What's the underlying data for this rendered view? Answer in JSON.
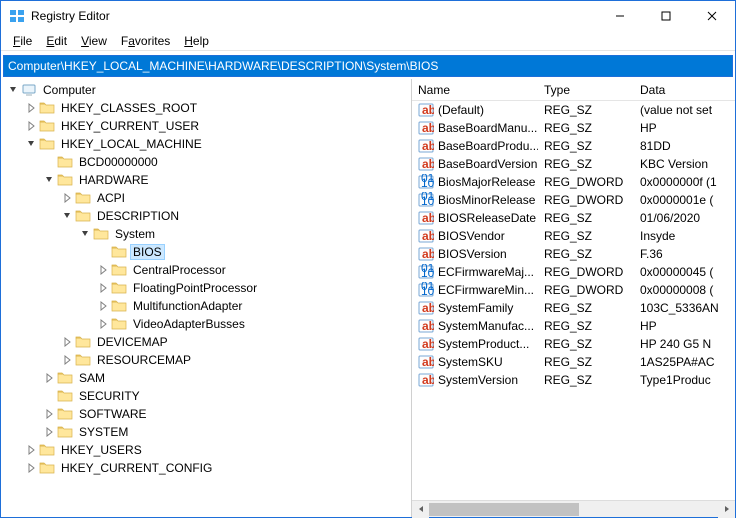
{
  "window": {
    "title": "Registry Editor"
  },
  "menu": {
    "file": "File",
    "edit": "Edit",
    "view": "View",
    "favorites": "Favorites",
    "help": "Help"
  },
  "address_path": "Computer\\HKEY_LOCAL_MACHINE\\HARDWARE\\DESCRIPTION\\System\\BIOS",
  "tree": [
    {
      "label": "Computer",
      "depth": 0,
      "expander": "open",
      "icon": "computer",
      "selected": false
    },
    {
      "label": "HKEY_CLASSES_ROOT",
      "depth": 1,
      "expander": "closed",
      "icon": "folder"
    },
    {
      "label": "HKEY_CURRENT_USER",
      "depth": 1,
      "expander": "closed",
      "icon": "folder"
    },
    {
      "label": "HKEY_LOCAL_MACHINE",
      "depth": 1,
      "expander": "open",
      "icon": "folder"
    },
    {
      "label": "BCD00000000",
      "depth": 2,
      "expander": "none",
      "icon": "folder"
    },
    {
      "label": "HARDWARE",
      "depth": 2,
      "expander": "open",
      "icon": "folder"
    },
    {
      "label": "ACPI",
      "depth": 3,
      "expander": "closed",
      "icon": "folder"
    },
    {
      "label": "DESCRIPTION",
      "depth": 3,
      "expander": "open",
      "icon": "folder"
    },
    {
      "label": "System",
      "depth": 4,
      "expander": "open",
      "icon": "folder"
    },
    {
      "label": "BIOS",
      "depth": 5,
      "expander": "none",
      "icon": "folder",
      "selected": true
    },
    {
      "label": "CentralProcessor",
      "depth": 5,
      "expander": "closed",
      "icon": "folder"
    },
    {
      "label": "FloatingPointProcessor",
      "depth": 5,
      "expander": "closed",
      "icon": "folder"
    },
    {
      "label": "MultifunctionAdapter",
      "depth": 5,
      "expander": "closed",
      "icon": "folder"
    },
    {
      "label": "VideoAdapterBusses",
      "depth": 5,
      "expander": "closed",
      "icon": "folder"
    },
    {
      "label": "DEVICEMAP",
      "depth": 3,
      "expander": "closed",
      "icon": "folder"
    },
    {
      "label": "RESOURCEMAP",
      "depth": 3,
      "expander": "closed",
      "icon": "folder"
    },
    {
      "label": "SAM",
      "depth": 2,
      "expander": "closed",
      "icon": "folder"
    },
    {
      "label": "SECURITY",
      "depth": 2,
      "expander": "none",
      "icon": "folder"
    },
    {
      "label": "SOFTWARE",
      "depth": 2,
      "expander": "closed",
      "icon": "folder"
    },
    {
      "label": "SYSTEM",
      "depth": 2,
      "expander": "closed",
      "icon": "folder"
    },
    {
      "label": "HKEY_USERS",
      "depth": 1,
      "expander": "closed",
      "icon": "folder"
    },
    {
      "label": "HKEY_CURRENT_CONFIG",
      "depth": 1,
      "expander": "closed",
      "icon": "folder"
    }
  ],
  "columns": {
    "name": "Name",
    "type": "Type",
    "data": "Data"
  },
  "values": [
    {
      "icon": "str",
      "name": "(Default)",
      "type": "REG_SZ",
      "data": "(value not set"
    },
    {
      "icon": "str",
      "name": "BaseBoardManu...",
      "type": "REG_SZ",
      "data": "HP"
    },
    {
      "icon": "str",
      "name": "BaseBoardProdu...",
      "type": "REG_SZ",
      "data": "81DD"
    },
    {
      "icon": "str",
      "name": "BaseBoardVersion",
      "type": "REG_SZ",
      "data": "KBC Version "
    },
    {
      "icon": "bin",
      "name": "BiosMajorRelease",
      "type": "REG_DWORD",
      "data": "0x0000000f (1"
    },
    {
      "icon": "bin",
      "name": "BiosMinorRelease",
      "type": "REG_DWORD",
      "data": "0x0000001e ("
    },
    {
      "icon": "str",
      "name": "BIOSReleaseDate",
      "type": "REG_SZ",
      "data": "01/06/2020"
    },
    {
      "icon": "str",
      "name": "BIOSVendor",
      "type": "REG_SZ",
      "data": "Insyde"
    },
    {
      "icon": "str",
      "name": "BIOSVersion",
      "type": "REG_SZ",
      "data": "F.36"
    },
    {
      "icon": "bin",
      "name": "ECFirmwareMaj...",
      "type": "REG_DWORD",
      "data": "0x00000045 ("
    },
    {
      "icon": "bin",
      "name": "ECFirmwareMin...",
      "type": "REG_DWORD",
      "data": "0x00000008 ("
    },
    {
      "icon": "str",
      "name": "SystemFamily",
      "type": "REG_SZ",
      "data": "103C_5336AN"
    },
    {
      "icon": "str",
      "name": "SystemManufac...",
      "type": "REG_SZ",
      "data": "HP"
    },
    {
      "icon": "str",
      "name": "SystemProduct...",
      "type": "REG_SZ",
      "data": "HP 240 G5 N"
    },
    {
      "icon": "str",
      "name": "SystemSKU",
      "type": "REG_SZ",
      "data": "1AS25PA#AC"
    },
    {
      "icon": "str",
      "name": "SystemVersion",
      "type": "REG_SZ",
      "data": "Type1Produc"
    }
  ]
}
